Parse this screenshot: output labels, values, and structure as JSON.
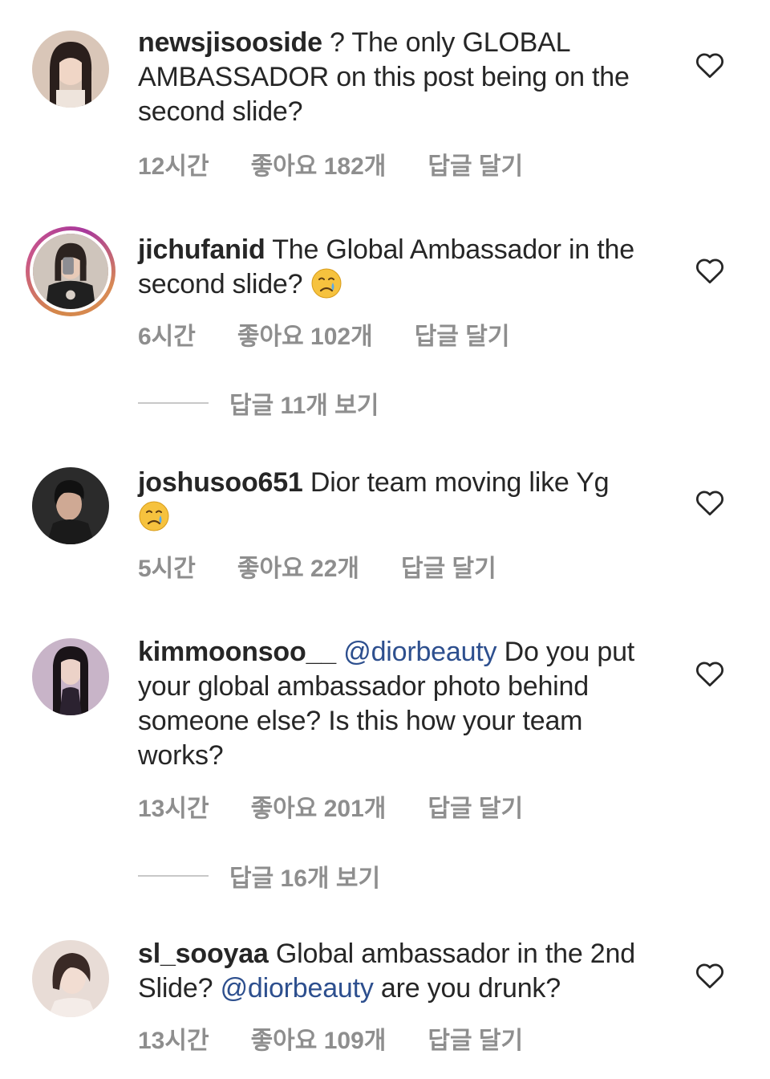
{
  "comments": [
    {
      "username": "newsjisooside",
      "body": " ? The only GLOBAL AMBASSADOR on this post being on the second slide?",
      "time": "12시간",
      "likes": "좋아요 182개",
      "reply_label": "답글 달기",
      "avatar_icon": "profile-photo",
      "has_story_ring": false
    },
    {
      "username": "jichufanid",
      "body": " The Global Ambassador in the second slide? ",
      "emoji": "crying-face",
      "time": "6시간",
      "likes": "좋아요 102개",
      "reply_label": "답글 달기",
      "avatar_icon": "profile-photo",
      "has_story_ring": true,
      "view_replies": "답글 11개 보기"
    },
    {
      "username": "joshusoo651",
      "body": " Dior team moving like Yg",
      "emoji": "crying-face",
      "time": "5시간",
      "likes": "좋아요 22개",
      "reply_label": "답글 달기",
      "avatar_icon": "profile-photo",
      "has_story_ring": false
    },
    {
      "username": "kimmoonsoo__",
      "mention": "@diorbeauty",
      "body": " Do you put your global ambassador photo behind someone else?  Is this how your team works?",
      "time": "13시간",
      "likes": "좋아요 201개",
      "reply_label": "답글 달기",
      "avatar_icon": "profile-photo",
      "has_story_ring": false,
      "view_replies": "답글 16개 보기"
    },
    {
      "username": "sl_sooyaa",
      "body": " Global ambassador in the 2nd Slide? ",
      "mention": "@diorbeauty",
      "body_after": " are you drunk?",
      "time": "13시간",
      "likes": "좋아요 109개",
      "reply_label": "답글 달기",
      "avatar_icon": "profile-photo",
      "has_story_ring": false
    }
  ],
  "colors": {
    "text": "#262626",
    "meta": "#8e8e8e",
    "mention": "#2d4f8e",
    "story_ring": "#c9568a"
  },
  "icons": {
    "like": "heart-outline-icon",
    "emoji": "crying-face-emoji"
  }
}
